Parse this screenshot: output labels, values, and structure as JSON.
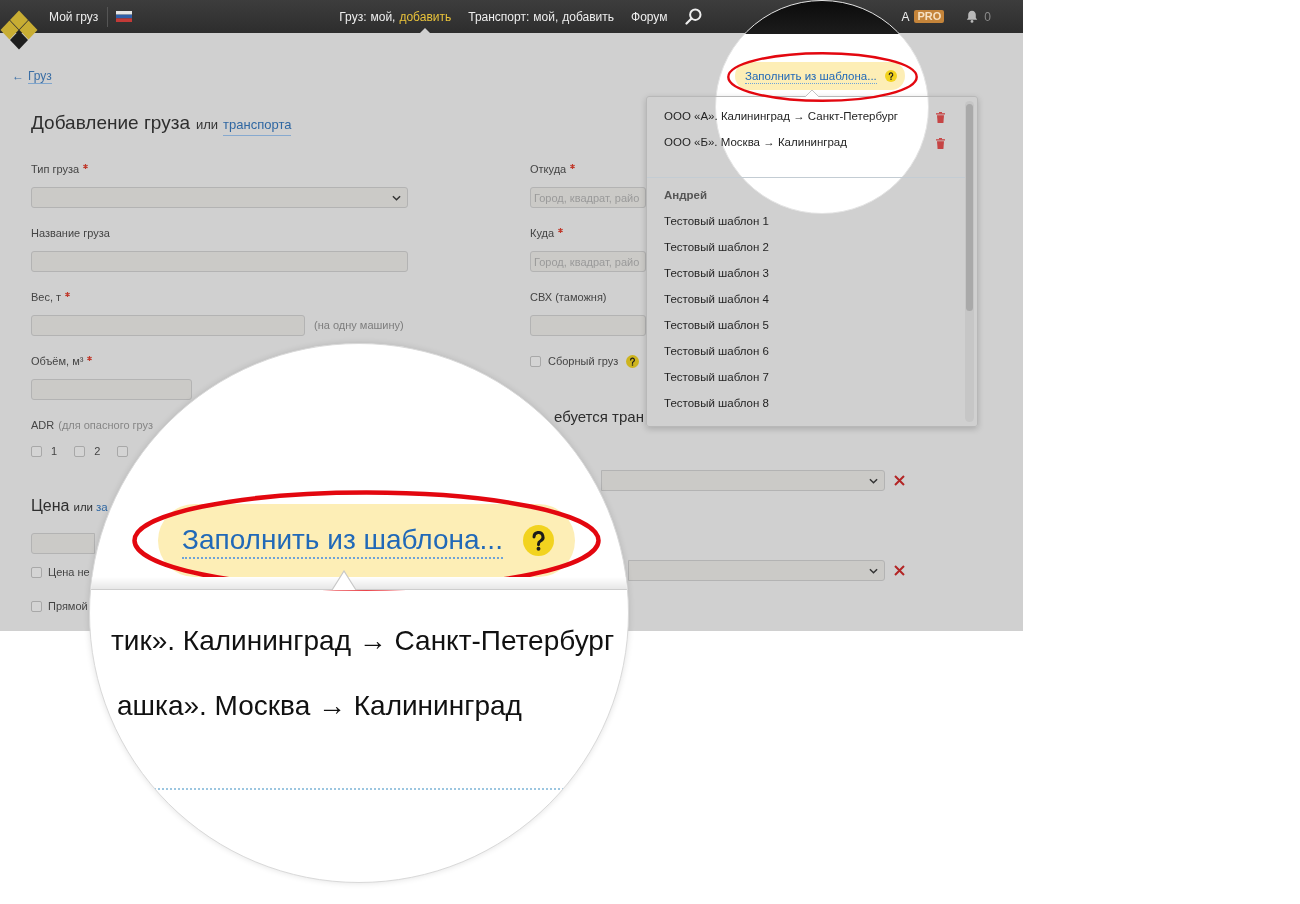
{
  "top_bar": {
    "home_link": "Мой груз",
    "menu": [
      {
        "label": "Груз:",
        "links": [
          {
            "text": "мой,",
            "selected": false
          },
          {
            "text": "добавить",
            "selected": true
          }
        ]
      },
      {
        "label": "Транспорт:",
        "links": [
          {
            "text": "мой,",
            "selected": false
          },
          {
            "text": "добавить",
            "selected": false
          }
        ]
      },
      {
        "links": [
          {
            "text": "Форум",
            "selected": false
          }
        ]
      }
    ],
    "user": "A",
    "badge": "PRO",
    "notifications": "0"
  },
  "back_link": {
    "arrow": "←",
    "label": "Груз"
  },
  "heading": {
    "title": "Добавление груза",
    "conjunction": "или",
    "link": "транспорта"
  },
  "cargo_fields": [
    {
      "kind": "select",
      "label": "Тип груза",
      "required": true
    },
    {
      "kind": "input",
      "label": "Название груза",
      "required": false
    },
    {
      "kind": "input",
      "label": "Вес, т",
      "required": true,
      "note": "(на одну машину)"
    },
    {
      "kind": "input",
      "label": "Объём, м³",
      "required": true
    }
  ],
  "adr": {
    "label": "ADR",
    "hint": "(для опасного груз",
    "options": [
      {
        "label": "1",
        "checked": false
      },
      {
        "label": "2",
        "checked": false
      },
      {
        "checked": false
      }
    ]
  },
  "price": {
    "title": "Цена",
    "conjunction": "или",
    "link": "за",
    "options": [
      {
        "label": "Цена не",
        "checked": false
      },
      {
        "label": "Прямой",
        "checked": false
      }
    ]
  },
  "route_fields": [
    {
      "kind": "input",
      "label": "Откуда",
      "required": true,
      "placeholder": "Город, квадрат, райо"
    },
    {
      "kind": "input",
      "label": "Куда",
      "required": true,
      "placeholder": "Город, квадрат, райо"
    },
    {
      "kind": "input",
      "label": "СВХ (таможня)",
      "required": false
    },
    {
      "kind": "checkbox",
      "label": "Сборный груз",
      "checked": false,
      "help": true
    }
  ],
  "transport": {
    "title": "ебуется тран",
    "rows": [
      {
        "kind": "select",
        "removable": true
      },
      {
        "kind": "select",
        "removable": true
      }
    ]
  },
  "template_button": {
    "label": "Заполнить из шаблона...",
    "help": true,
    "highlighted": true
  },
  "template_menu": {
    "sections": [
      {
        "items": [
          {
            "label": "ООО «А». Калининград → Санкт-Петербург",
            "deletable": true
          },
          {
            "label": "ООО «Б». Москва → Калининград",
            "deletable": true
          }
        ]
      },
      {
        "title": "Андрей",
        "items": [
          {
            "label": "Тестовый шаблон 1",
            "deletable": false
          },
          {
            "label": "Тестовый шаблон 2",
            "deletable": false
          },
          {
            "label": "Тестовый шаблон 3",
            "deletable": false
          },
          {
            "label": "Тестовый шаблон 4",
            "deletable": false
          },
          {
            "label": "Тестовый шаблон 5",
            "deletable": false
          },
          {
            "label": "Тестовый шаблон 6",
            "deletable": false
          },
          {
            "label": "Тестовый шаблон 7",
            "deletable": false
          },
          {
            "label": "Тестовый шаблон 8",
            "deletable": false
          }
        ]
      }
    ]
  },
  "magnifier": {
    "button": {
      "label": "Заполнить из шаблона...",
      "help": true,
      "highlighted": true
    },
    "items": [
      "тик». Калининград → Санкт-Петербург",
      "ашка». Москва → Калининград"
    ]
  }
}
